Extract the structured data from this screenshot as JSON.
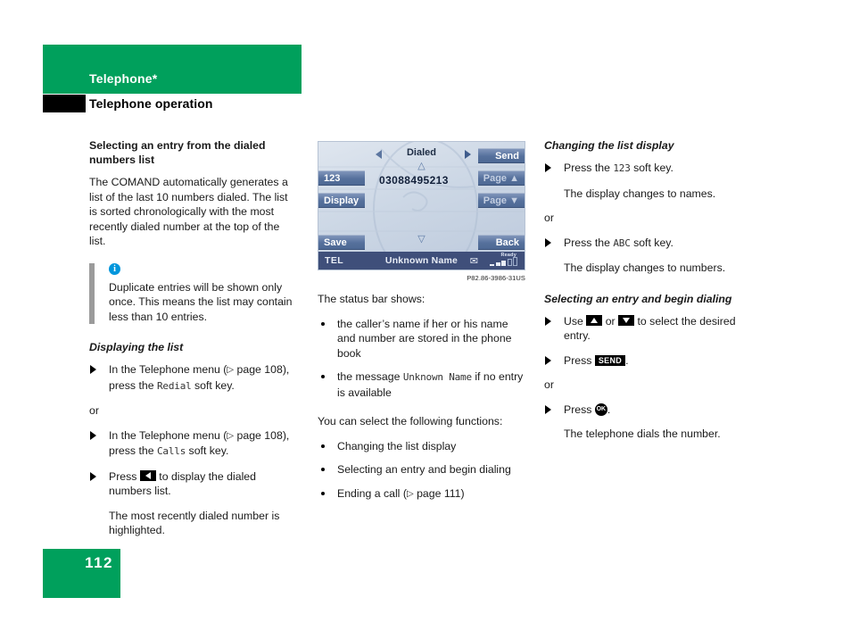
{
  "header": {
    "chapter": "Telephone*",
    "section": "Telephone operation"
  },
  "footer": {
    "page_number": "112"
  },
  "colors": {
    "brand_green": "#00a05c",
    "info_blue": "#0096dc",
    "note_bar_gray": "#9b9b9b",
    "screen_status_bar": "#3f4f7a"
  },
  "col1": {
    "heading": "Selecting an entry from the dialed numbers list",
    "intro": "The COMAND automatically generates a list of the last 10 numbers dialed. The list is sorted chronologically with the most recently dialed number at the top of the list.",
    "note": {
      "icon": "info-icon",
      "text": "Duplicate entries will be shown only once. This means the list may contain less than 10 entries."
    },
    "subheading": "Displaying the list",
    "step1_a": "In the Telephone menu (",
    "step1_ref": "page 108",
    "step1_b": "), press the ",
    "step1_key": "Redial",
    "step1_c": " soft key.",
    "or": "or",
    "step2_a": "In the Telephone menu (",
    "step2_ref": "page 108",
    "step2_b": "), press the ",
    "step2_key": "Calls",
    "step2_c": " soft key.",
    "step3_a": "Press ",
    "step3_key_icon": "left-arrow-key",
    "step3_b": " to display the dialed numbers list.",
    "step3_result": "The most recently dialed number is highlighted."
  },
  "screen": {
    "title": "Dialed",
    "left_arrow_icon": "left-triangle-icon",
    "right_arrow_icon": "right-triangle-icon",
    "scroll_up_icon": "scroll-up-triangle-icon",
    "scroll_down_icon": "scroll-down-triangle-icon",
    "number": "03088495213",
    "buttons_left": [
      {
        "label": "123",
        "name": "softkey-123"
      },
      {
        "label": "Display",
        "name": "softkey-display"
      },
      {
        "label": "Save",
        "name": "softkey-save"
      }
    ],
    "buttons_right": [
      {
        "label": "Send",
        "name": "softkey-send"
      },
      {
        "label": "Page ▲",
        "name": "softkey-page-up"
      },
      {
        "label": "Page ▼",
        "name": "softkey-page-down"
      },
      {
        "label": "Back",
        "name": "softkey-back"
      }
    ],
    "status": {
      "mode": "TEL",
      "name": "Unknown Name",
      "envelope_icon": "envelope-icon",
      "ready_label": "Ready"
    },
    "caption": "P82.86-3986-31US"
  },
  "col2": {
    "lead": "The status bar shows:",
    "bullet1": "the caller’s name if her or his name and number are stored in the phone book",
    "bullet2_a": "the message ",
    "bullet2_key": "Unknown Name",
    "bullet2_b": " if no entry is available",
    "lead2": "You can select the following functions:",
    "bullet3": "Changing the list display",
    "bullet4": "Selecting an entry and begin dialing",
    "bullet5_a": "Ending a call (",
    "bullet5_ref": "page 111",
    "bullet5_b": ")"
  },
  "col3": {
    "heading1": "Changing the list display",
    "s1_a": "Press the ",
    "s1_key": "123",
    "s1_b": " soft key.",
    "s1_result": "The display changes to names.",
    "or1": "or",
    "s2_a": "Press the ",
    "s2_key": "ABC",
    "s2_b": " soft key.",
    "s2_result": "The display changes to numbers.",
    "heading2": "Selecting an entry and begin dialing",
    "s3_a": "Use ",
    "s3_key_up": "up-arrow-key",
    "s3_mid": " or ",
    "s3_key_down": "down-arrow-key",
    "s3_b": " to select the desired entry.",
    "s4_a": "Press ",
    "s4_key": "SEND",
    "s4_b": ".",
    "or2": "or",
    "s5_a": "Press ",
    "s5_key": "OK",
    "s5_b": ".",
    "s5_result": "The telephone dials the number."
  }
}
